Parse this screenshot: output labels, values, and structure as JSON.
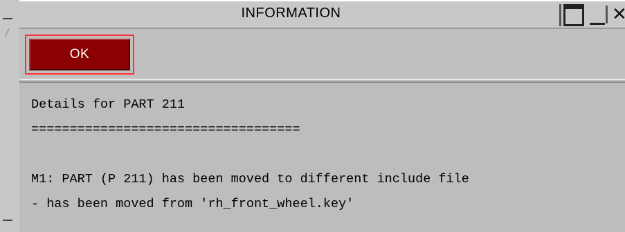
{
  "window": {
    "title": "INFORMATION"
  },
  "controls": {
    "ok_label": "OK"
  },
  "icons": {
    "maximize": "maximize-icon",
    "minimize": "minimize-icon",
    "close": "close-icon",
    "menu": "window-menu-icon"
  },
  "colors": {
    "ok_button_bg": "#8b0000",
    "focus_border": "#ff3333",
    "window_bg": "#bdbdbd"
  },
  "content": {
    "lines": [
      "Details for PART 211",
      "===================================",
      "",
      "M1: PART (P 211) has been moved to different include file",
      "- has been moved from 'rh_front_wheel.key'"
    ]
  }
}
